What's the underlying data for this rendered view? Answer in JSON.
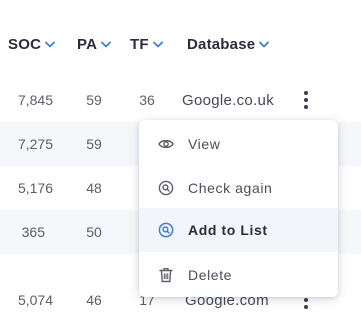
{
  "table": {
    "columns": [
      {
        "key": "soc",
        "label": "SOC"
      },
      {
        "key": "pa",
        "label": "PA"
      },
      {
        "key": "tf",
        "label": "TF"
      },
      {
        "key": "database",
        "label": "Database"
      }
    ],
    "rows": [
      {
        "soc": "7,845",
        "pa": "59",
        "tf": "36",
        "database": "Google.co.uk"
      },
      {
        "soc": "7,275",
        "pa": "59",
        "tf": "",
        "database": ""
      },
      {
        "soc": "5,176",
        "pa": "48",
        "tf": "",
        "database": ""
      },
      {
        "soc": "365",
        "pa": "50",
        "tf": "",
        "database": ""
      },
      {
        "soc": "5,074",
        "pa": "46",
        "tf": "17",
        "database": "Google.com"
      }
    ]
  },
  "menu": {
    "items": [
      {
        "label": "View",
        "icon": "eye-icon"
      },
      {
        "label": "Check again",
        "icon": "search-circle-icon"
      },
      {
        "label": "Add to List",
        "icon": "add-to-list-icon"
      },
      {
        "label": "Delete",
        "icon": "trash-icon"
      }
    ],
    "active_index": 2
  },
  "colors": {
    "accent": "#3f7fd6",
    "header_text": "#2b2d3b",
    "row_alt_bg": "#f6f7fb"
  }
}
